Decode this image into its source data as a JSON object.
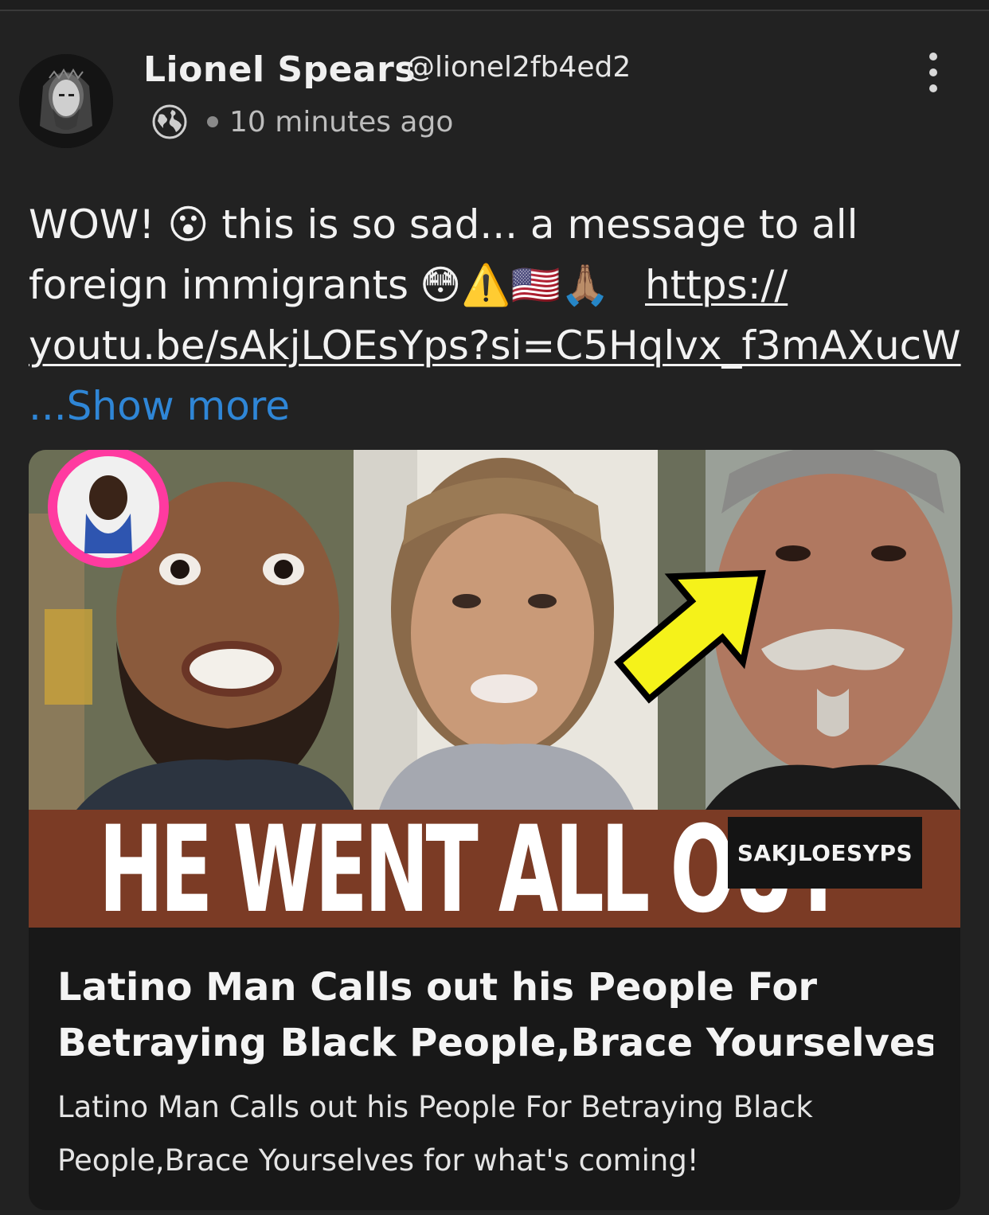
{
  "post": {
    "author_name": "Lionel Spears",
    "author_handle": "@lionel2fb4ed2",
    "visibility_icon": "globe-icon",
    "timestamp": "10 minutes ago",
    "menu_icon": "more-vertical-icon",
    "text": {
      "line1_a": "WOW!",
      "line1_emoji": "😮",
      "line1_b": "this is so sad... a message to all",
      "line2_a": "foreign immigrants",
      "line2_emojis": "😳⚠️🇺🇸🙏🏽",
      "link_part1": "https://",
      "link_part2": "youtu.be/sAkjLOEsYps?si=C5Hqlvx_f3mAXucW",
      "show_more": "...Show more"
    }
  },
  "link_card": {
    "thumbnail_caption": "HE WENT ALL OUT",
    "channel_badge": "SAKJLOESYPS",
    "title_line1": "Latino Man Calls out his People For",
    "title_line2": "Betraying Black People,Brace Yourselves f...",
    "description_line1": "Latino Man Calls out his People For Betraying Black",
    "description_line2": "People,Brace Yourselves for what's coming!"
  },
  "colors": {
    "background": "#222222",
    "link_blue": "#2f86d6",
    "banner_brown": "#7b3b25",
    "arrow_yellow": "#f5f21a"
  }
}
